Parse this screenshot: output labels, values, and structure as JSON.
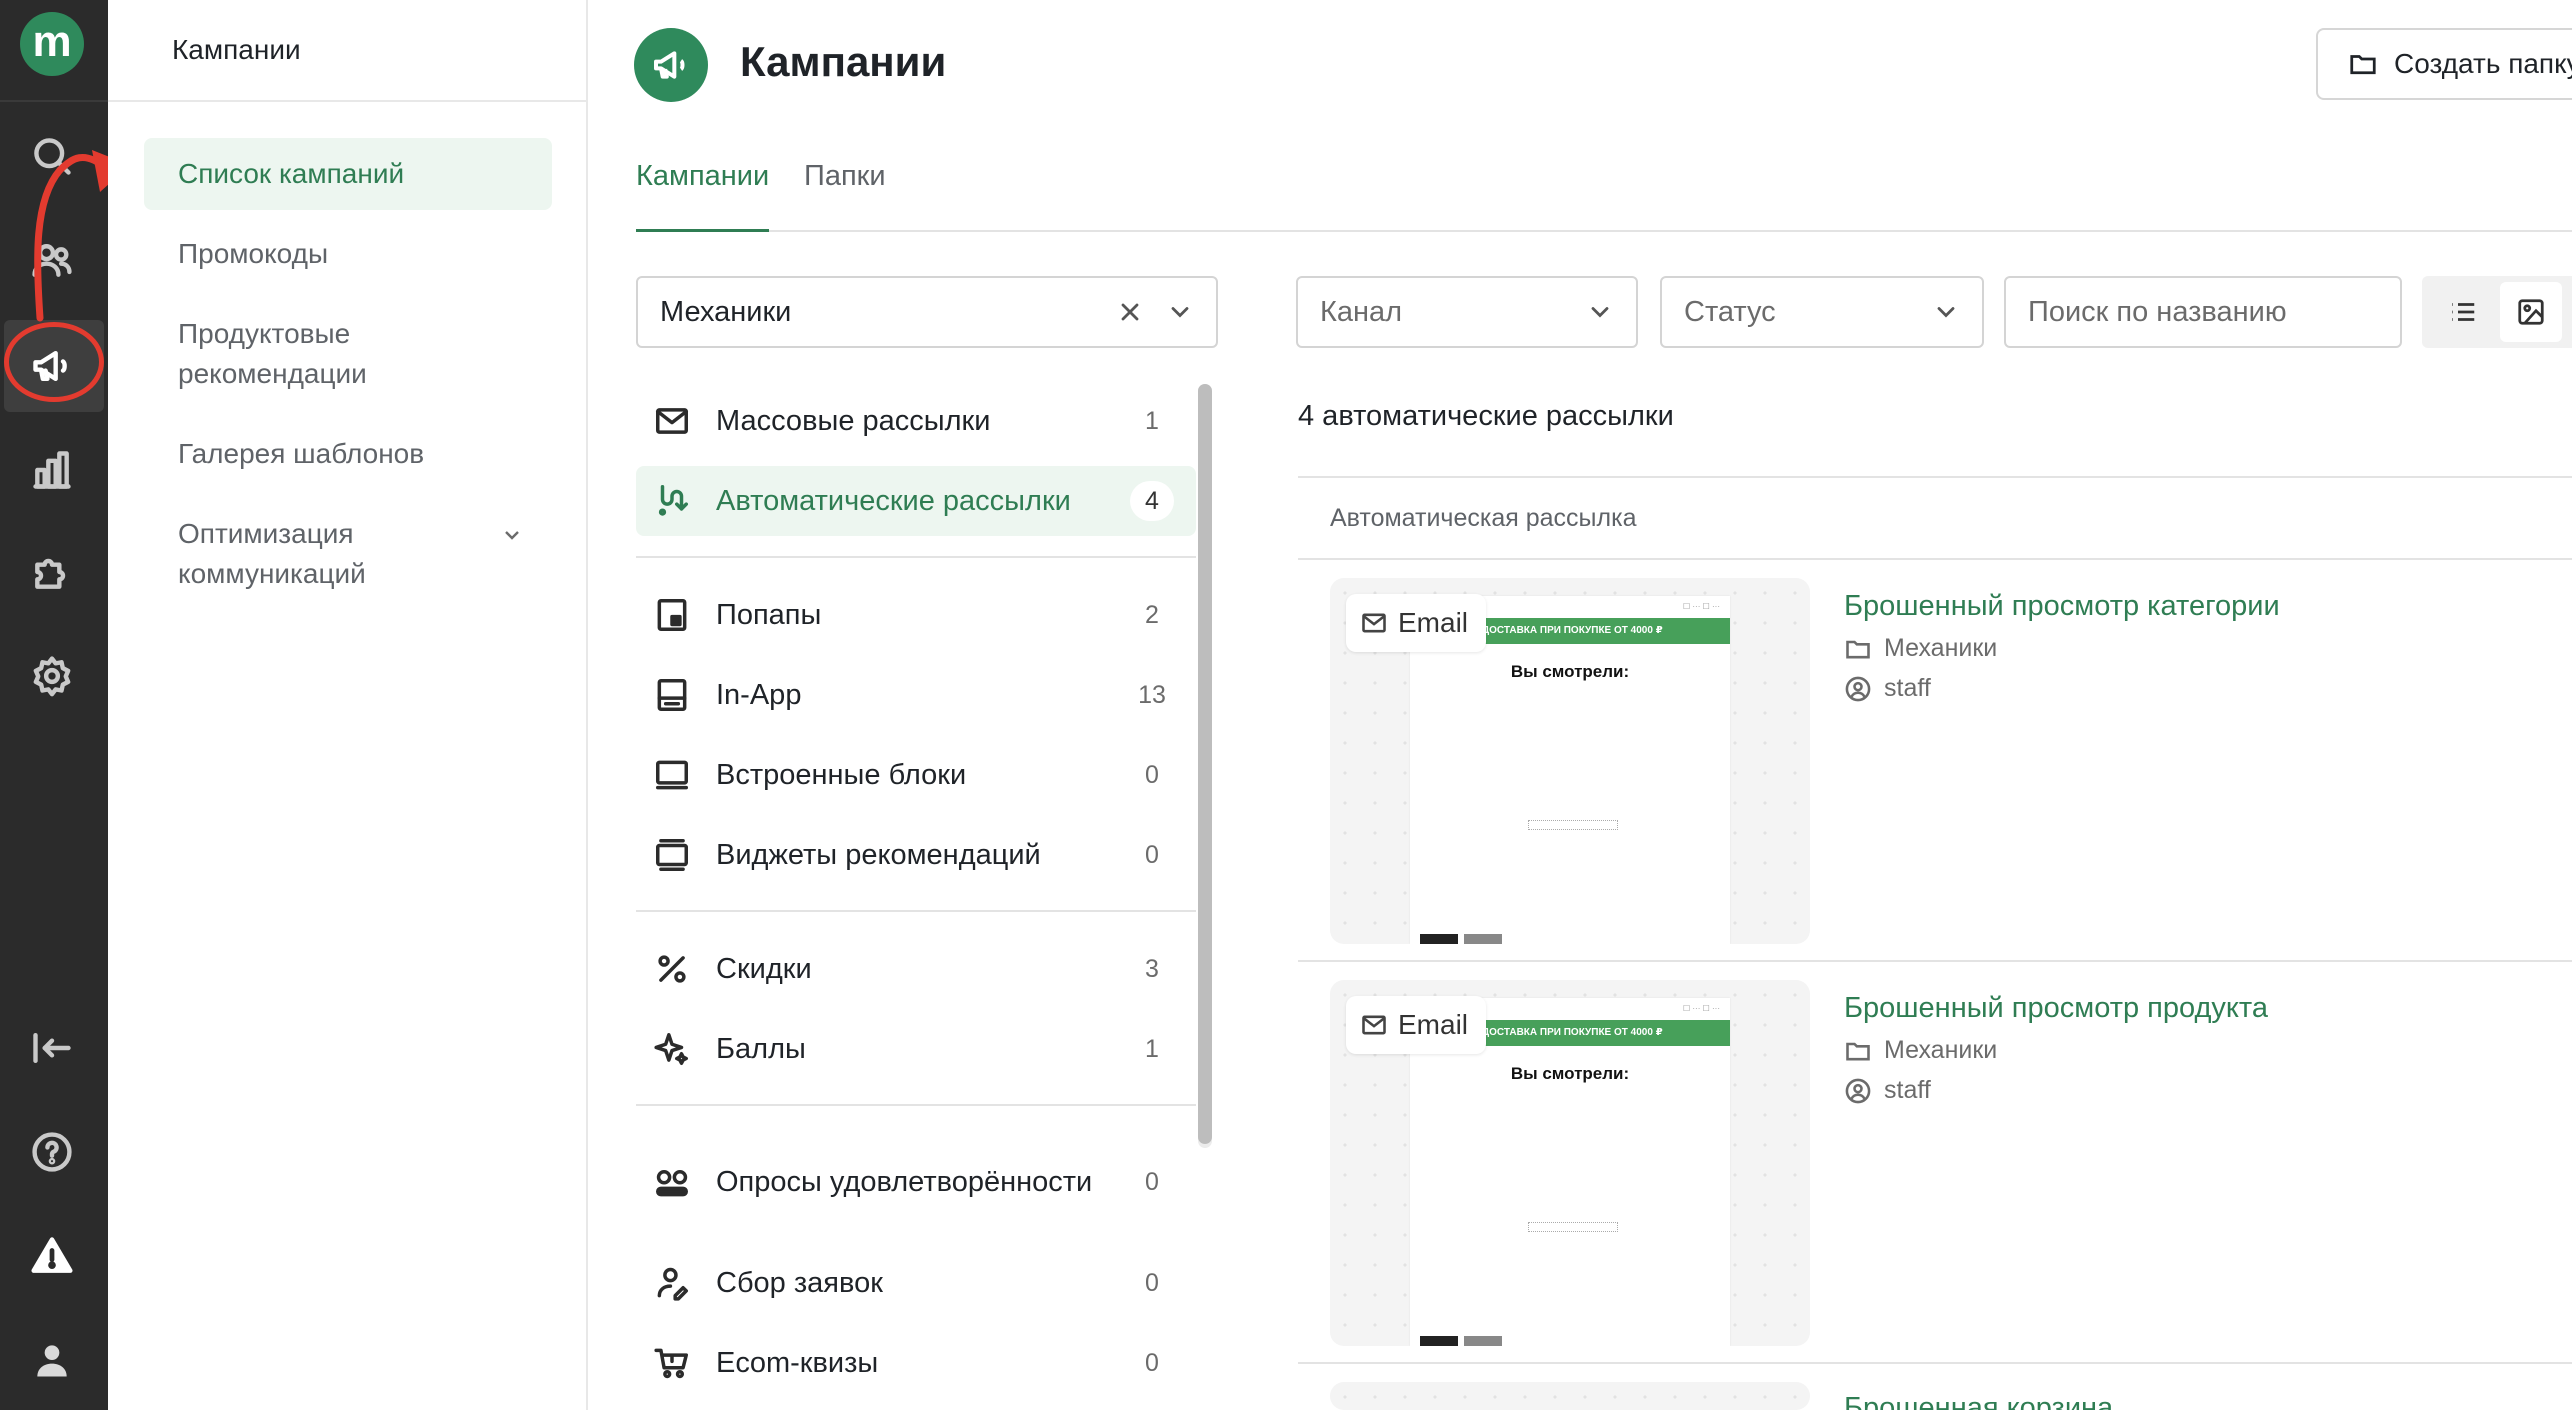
{
  "rail": {
    "logo": "m",
    "icons": [
      "search-icon",
      "users-icon",
      "megaphone-icon",
      "chart-icon",
      "puzzle-icon",
      "gear-icon",
      "collapse-icon",
      "help-icon",
      "warning-icon",
      "user-icon"
    ],
    "active": "megaphone-icon"
  },
  "sidebar": {
    "header": "Кампании",
    "items": [
      {
        "label": "Список кампаний"
      },
      {
        "label": "Промокоды"
      },
      {
        "label": "Продуктовые рекомендации"
      },
      {
        "label": "Галерея шаблонов"
      },
      {
        "label": "Оптимизация коммуникаций"
      }
    ]
  },
  "main": {
    "title": "Кампании",
    "create_button": "Создать папку",
    "tabs": [
      {
        "label": "Кампании"
      },
      {
        "label": "Папки"
      }
    ],
    "filters": {
      "mechanics": "Механики",
      "channel": "Канал",
      "status": "Статус",
      "search_placeholder": "Поиск по названию"
    },
    "channels": [
      {
        "label": "Массовые рассылки",
        "count": "1"
      },
      {
        "label": "Автоматические рассылки",
        "count": "4"
      },
      {
        "label": "Попапы",
        "count": "2"
      },
      {
        "label": "In-App",
        "count": "13"
      },
      {
        "label": "Встроенные блоки",
        "count": "0"
      },
      {
        "label": "Виджеты рекомендаций",
        "count": "0"
      },
      {
        "label": "Скидки",
        "count": "3"
      },
      {
        "label": "Баллы",
        "count": "1"
      },
      {
        "label": "Опросы удовлетворённости",
        "count": "0"
      },
      {
        "label": "Сбор заявок",
        "count": "0"
      },
      {
        "label": "Ecom-квизы",
        "count": "0"
      }
    ],
    "list_title": "4 автоматические рассылки",
    "group_label": "Автоматическая рассылка",
    "campaigns": [
      {
        "name": "Брошенный просмотр категории",
        "folder": "Механики",
        "owner": "staff",
        "badge": "Email",
        "preview_bar": "ДОСТАВКА ПРИ ПОКУПКЕ ОТ 4000 ₽",
        "preview_text": "Вы смотрели:"
      },
      {
        "name": "Брошенный просмотр продукта",
        "folder": "Механики",
        "owner": "staff",
        "badge": "Email",
        "preview_bar": "ДОСТАВКА ПРИ ПОКУПКЕ ОТ 4000 ₽",
        "preview_text": "Вы смотрели:"
      },
      {
        "name": "Брошенная корзина",
        "folder": "",
        "owner": "",
        "badge": "",
        "preview_bar": "",
        "preview_text": ""
      }
    ]
  },
  "colors": {
    "accent": "#2f8a5c",
    "accent_text": "#2f7d53",
    "active_bg": "#edf6f0",
    "rail_bg": "#2b2b2b",
    "annotation": "#e33b2f"
  }
}
